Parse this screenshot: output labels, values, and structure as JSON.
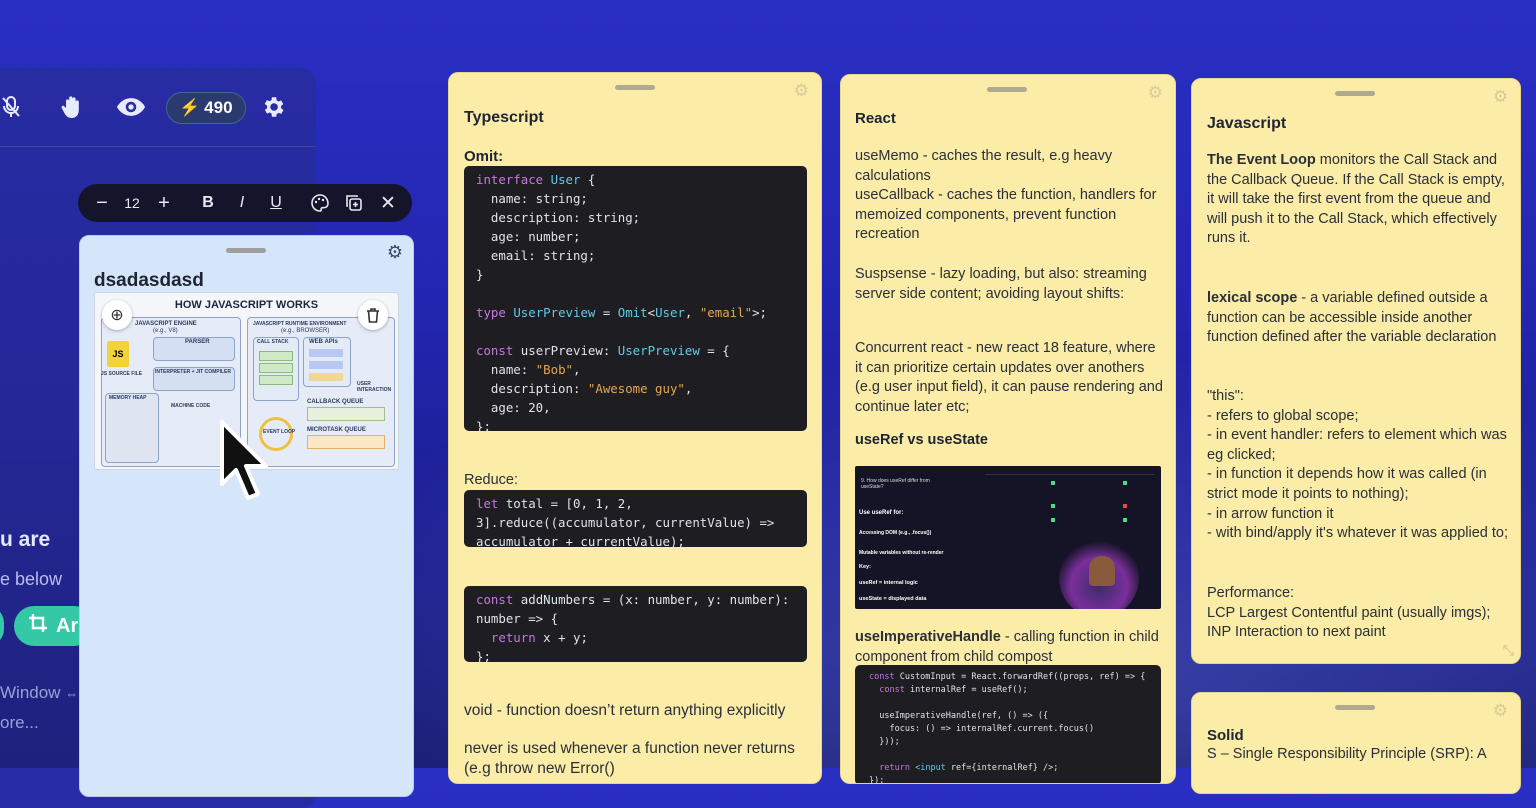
{
  "toolbar": {
    "points": "490",
    "icons": [
      "mic-off-icon",
      "hand-icon",
      "eye-icon",
      "bolt-icon",
      "gear-icon"
    ]
  },
  "left_snippets": {
    "line1": "u are",
    "line2": "e below",
    "button_label": "Ar",
    "line3": "Window",
    "line4": "ore..."
  },
  "format_bar": {
    "minus": "−",
    "font_size": "12",
    "plus": "+",
    "bold": "B",
    "italic": "I",
    "underline": "U"
  },
  "blue_card": {
    "title": "dsadasdasd",
    "diagram": {
      "title": "HOW JAVASCRIPT WORKS",
      "engine": "JAVASCRIPT ENGINE",
      "engine_sub": "(e.g., V8)",
      "runtime": "JAVASCRIPT RUNTIME ENVIRONMENT",
      "runtime_sub": "(e.g., BROWSER)",
      "parser": "PARSER",
      "compiler": "INTERPRETER + JIT COMPILER",
      "machine_code": "MACHINE CODE",
      "memory_heap": "MEMORY HEAP",
      "call_stack": "CALL STACK",
      "web_apis": "WEB APIs",
      "callback_queue": "CALLBACK QUEUE",
      "microtask_queue": "MICROTASK QUEUE",
      "event_loop": "EVENT LOOP",
      "js_source": "JS SOURCE FILE",
      "user_interaction": "USER INTERACTION"
    }
  },
  "typescript_card": {
    "title": "Typescript",
    "omit_label": "Omit:",
    "reduce_label": "Reduce:",
    "void_text": "void -   function doesn’t return anything explicitly",
    "never_text": "never is used whenever a function never returns (e.g throw new Error()"
  },
  "react_card": {
    "title": "React",
    "usememo": "useMemo - caches the result, e.g heavy calculations",
    "usecallback": "useCallback - caches the function, handlers for memoized components, prevent function recreation",
    "suspense": "Suspsense - lazy loading, but also: streaming server side content; avoiding layout shifts:",
    "concurrent": "Concurrent react - new react 18 feature, where it can prioritize certain updates over anothers (e.g user input field), it can pause rendering and continue later etc;",
    "useref_heading": "useRef vs useState",
    "imperative_bold": "useImperativeHandle",
    "imperative_rest": " - calling function in child component from child compost",
    "shot_title": "9. How does useRef differ from useState?",
    "shot_use_ref_for": "Use useRef for:",
    "shot_accessing_dom": "Accessing DOM (e.g., .focus())",
    "shot_mutable": "Mutable variables without re-render",
    "shot_key": "Key:",
    "shot_useref_internal": "useRef = internal logic",
    "shot_usestate_displayed": "useState = displayed data"
  },
  "javascript_card": {
    "title": "Javascript",
    "event_loop_bold": "The Event Loop",
    "event_loop_rest": " monitors the Call Stack and the Callback Queue. If the Call Stack is empty, it will take the first event from the queue and will push it to the Call Stack, which effectively runs it.",
    "lexical_bold": "lexical scope",
    "lexical_rest": " -  a variable defined outside a function can be accessible inside another function defined after the variable declaration",
    "this_lines": [
      "\"this\":",
      "- refers to global scope;",
      "- in event handler: refers to element which was eg clicked;",
      "- in function it depends how it was called (in strict mode it points to nothing);",
      "- in arrow function it",
      "- with bind/apply it's whatever it was applied to;"
    ],
    "performance_lines": [
      "Performance:",
      "LCP Largest Contentful paint (usually imgs);",
      "INP Interaction to next paint"
    ]
  },
  "solid_card": {
    "title": "Solid",
    "line1": "S – Single Responsibility Principle (SRP): A"
  },
  "colors": {
    "background": "#2326b0",
    "sticky_yellow": "#fbeca7",
    "sticky_blue": "#d6e6fa",
    "accent_green": "#34c8a6",
    "code_bg": "#1e1e22"
  }
}
